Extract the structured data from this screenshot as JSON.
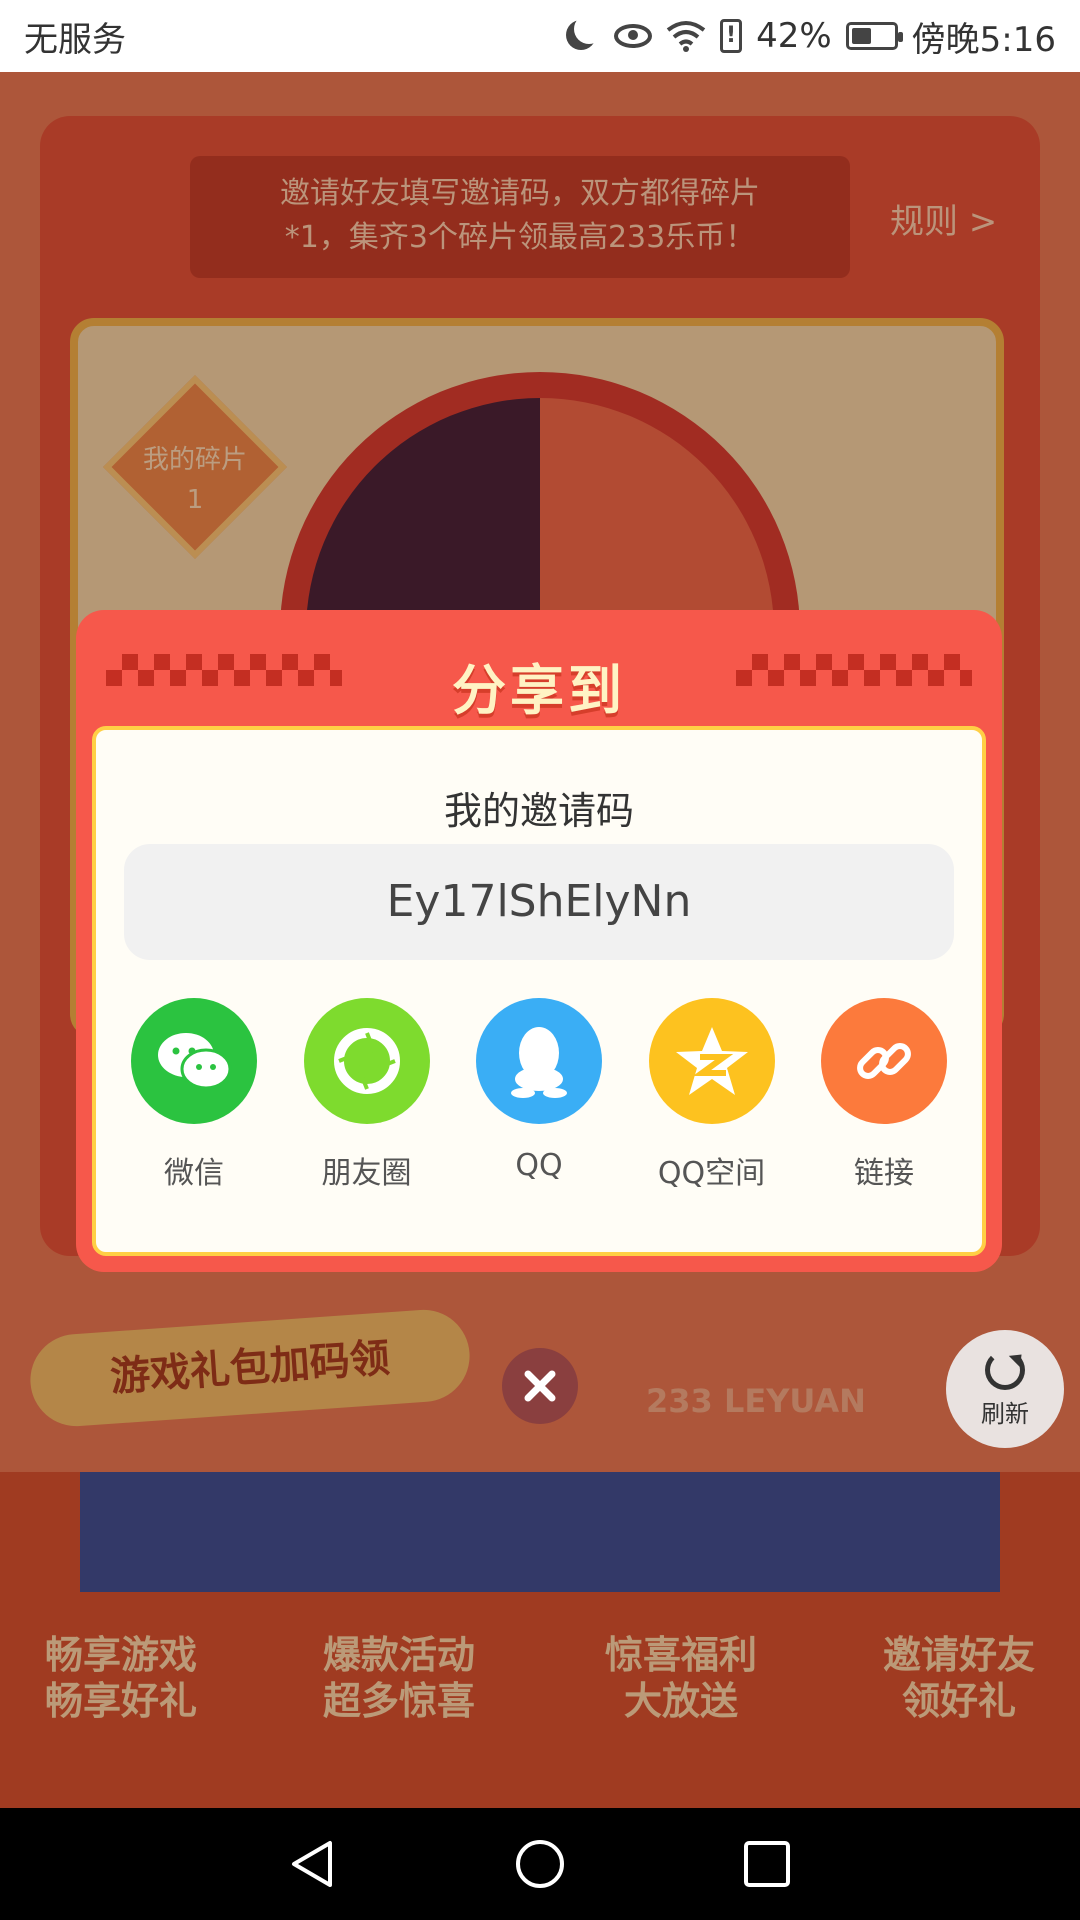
{
  "status_bar": {
    "carrier": "无服务",
    "battery_pct": "42%",
    "time": "傍晚5:16",
    "icons": [
      "moon-icon",
      "eye-icon",
      "wifi-icon",
      "alert-icon",
      "battery-icon"
    ]
  },
  "background": {
    "banner_text_line1": "邀请好友填写邀请码，双方都得碎片",
    "banner_text_line2": "*1，集齐3个碎片领最高233乐币！",
    "rules_link": "规则 >",
    "my_fragments_label": "我的碎片",
    "my_fragments_count": "1",
    "gift_banner": "游戏礼包加码领",
    "brand_text": "233 LEYUAN",
    "captions": [
      {
        "line1": "畅享游戏",
        "line2": "畅享好礼"
      },
      {
        "line1": "爆款活动",
        "line2": "超多惊喜"
      },
      {
        "line1": "惊喜福利",
        "line2": "大放送"
      },
      {
        "line1": "邀请好友",
        "line2": "领好礼"
      }
    ]
  },
  "refresh_button": {
    "label": "刷新"
  },
  "share_dialog": {
    "title": "分享到",
    "code_label": "我的邀请码",
    "invite_code": "Ey17lShElyNn",
    "targets": [
      {
        "label": "微信",
        "icon": "wechat-icon",
        "color": "#2bc340"
      },
      {
        "label": "朋友圈",
        "icon": "moments-icon",
        "color": "#7edb2e"
      },
      {
        "label": "QQ",
        "icon": "qq-icon",
        "color": "#3aaef5"
      },
      {
        "label": "QQ空间",
        "icon": "qzone-icon",
        "color": "#fdc21f"
      },
      {
        "label": "链接",
        "icon": "link-icon",
        "color": "#fc7a3c"
      }
    ]
  },
  "navigation": [
    "back-icon",
    "home-icon",
    "recents-icon"
  ]
}
